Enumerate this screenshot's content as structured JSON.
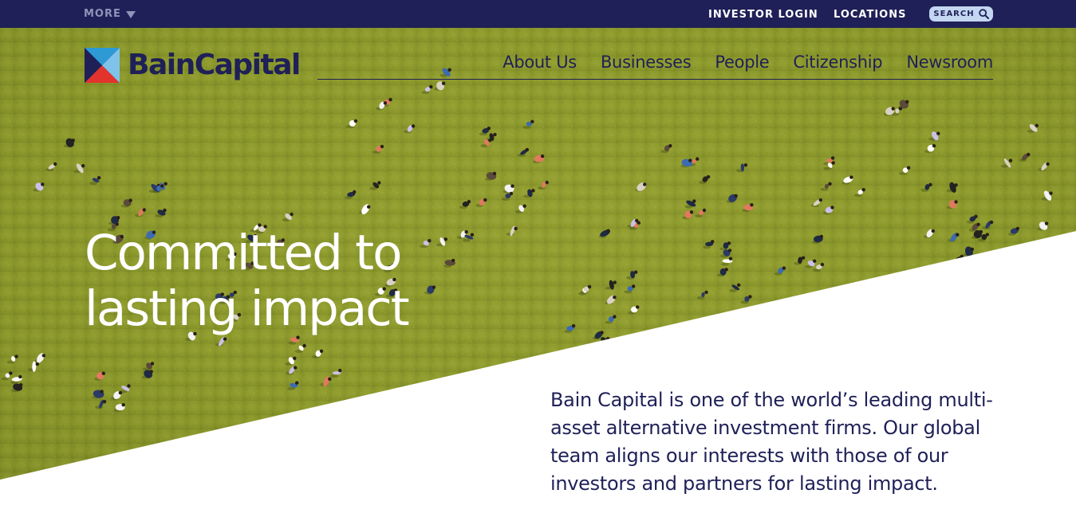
{
  "utility": {
    "more_label": "MORE",
    "investor_login": "INVESTOR LOGIN",
    "locations": "LOCATIONS",
    "search_label": "SEARCH"
  },
  "brand": {
    "name": "BainCapital",
    "colors": {
      "navy": "#1f2057",
      "grass": "#8e9a2e",
      "logo_blue": "#2d9ad6",
      "logo_red": "#e2342d",
      "search_pill": "#c3d6f2"
    }
  },
  "nav": {
    "items": [
      "About Us",
      "Businesses",
      "People",
      "Citizenship",
      "Newsroom"
    ]
  },
  "hero": {
    "headline_line1": "Committed to",
    "headline_line2": "lasting impact",
    "intro": "Bain Capital is one of the world’s leading multi-asset alternative investment firms. Our global team aligns our interests with those of our investors and partners for lasting impact."
  }
}
